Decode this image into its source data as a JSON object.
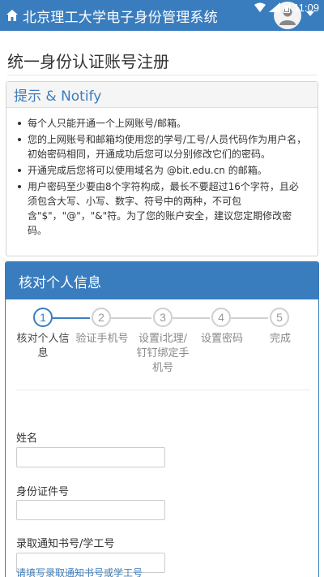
{
  "app_bar": {
    "title": "北京理工大学电子身份管理系统"
  },
  "status_bar": {
    "time": "11:09"
  },
  "page": {
    "title": "统一身份认证账号注册"
  },
  "notify": {
    "heading": "提示 & Notify",
    "items": [
      "每个人只能开通一个上网账号/邮箱。",
      "您的上网账号和邮箱均使用您的学号/工号/人员代码作为用户名，初始密码相同，开通成功后您可以分别修改它们的密码。",
      "开通完成后您将可以使用域名为 @bit.edu.cn 的邮箱。",
      "用户密码至少要由8个字符构成，最长不要超过16个字符，且必须包含大写、小写、数字、符号中的两种，不可包含\"$\"，\"@\"，\"&\"符。为了您的账户安全，建议您定期修改密码。"
    ]
  },
  "info_panel": {
    "heading": "核对个人信息",
    "current_step": 1,
    "steps": [
      {
        "number": "1",
        "label": "核对个人信息"
      },
      {
        "number": "2",
        "label": "验证手机号"
      },
      {
        "number": "3",
        "label": "设置i北理/钉钉绑定手机号"
      },
      {
        "number": "4",
        "label": "设置密码"
      },
      {
        "number": "5",
        "label": "完成"
      }
    ],
    "fields": [
      {
        "label": "姓名",
        "value": ""
      },
      {
        "label": "身份证件号",
        "value": ""
      },
      {
        "label": "录取通知书号/学工号",
        "value": ""
      }
    ],
    "hint": "请填写录取通知书号或学工号"
  },
  "colors": {
    "primary": "#3a7dbf",
    "border": "#d5d5d5",
    "text": "#333333"
  }
}
